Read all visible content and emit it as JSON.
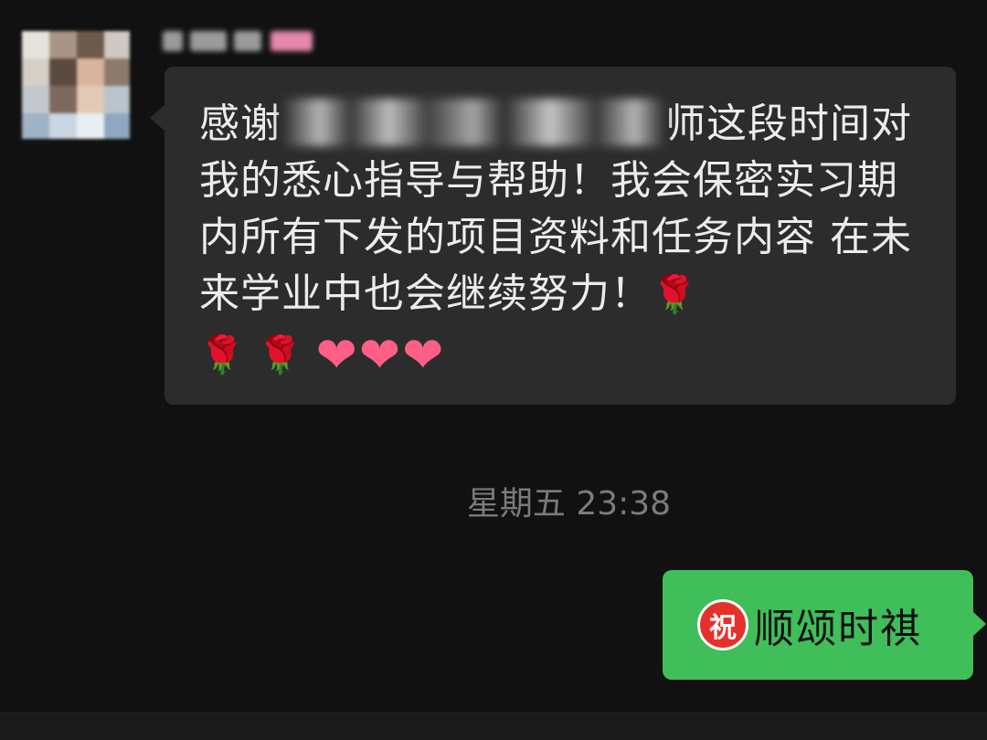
{
  "incoming": {
    "text_before": "感谢",
    "text_after": "师这段时间对我的悉心指导与帮助！我会保密实习期内所有下发的项目资料和任务内容 在未来学业中也会继续努力！",
    "emojis": {
      "rose": "🌹",
      "heart": "❤"
    }
  },
  "timestamp": "星期五 23:38",
  "outgoing": {
    "badge": "祝",
    "text": "顺颂时祺"
  },
  "colors": {
    "background": "#111111",
    "incoming_bubble": "#2c2c2c",
    "outgoing_bubble": "#3fbe5a",
    "timestamp": "#7b7b7b",
    "badge": "#e5312b"
  }
}
